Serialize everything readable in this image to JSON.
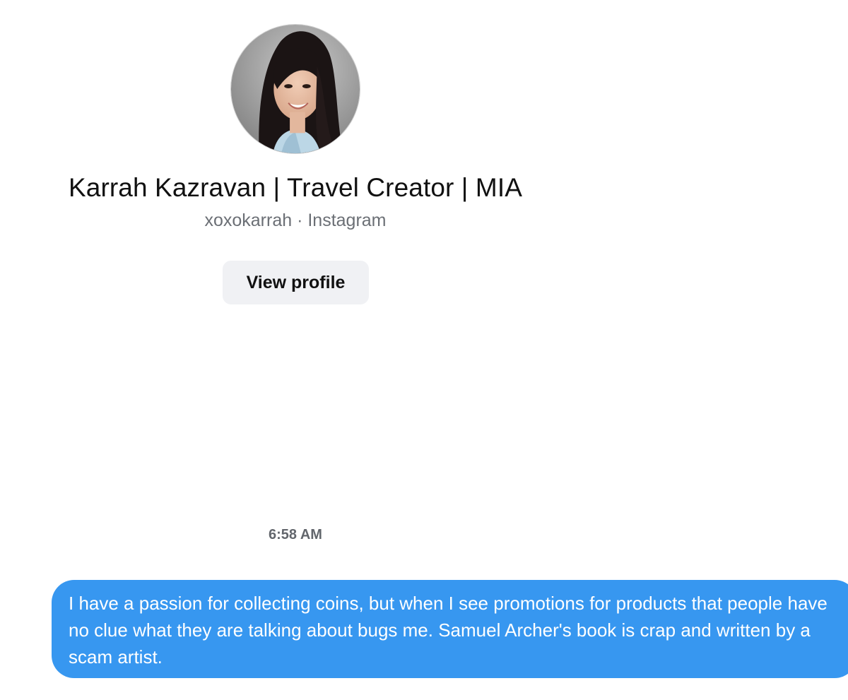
{
  "profile": {
    "name": "Karrah Kazravan | Travel Creator | MIA",
    "username": "xoxokarrah",
    "separator": "·",
    "platform": "Instagram",
    "subtitle": "xoxokarrah · Instagram",
    "view_profile_label": "View profile",
    "avatar_icon": "profile-photo"
  },
  "thread": {
    "timestamp": "6:58 AM",
    "messages": [
      {
        "from": "me",
        "text": "I have a passion for collecting coins, but when I see promotions for products that people have no clue what they are talking about bugs me. Samuel Archer's book is crap and written by a scam artist."
      }
    ]
  },
  "colors": {
    "bubble": "#3797f0",
    "button_bg": "#f0f1f4",
    "muted_text": "#6b6f75"
  }
}
